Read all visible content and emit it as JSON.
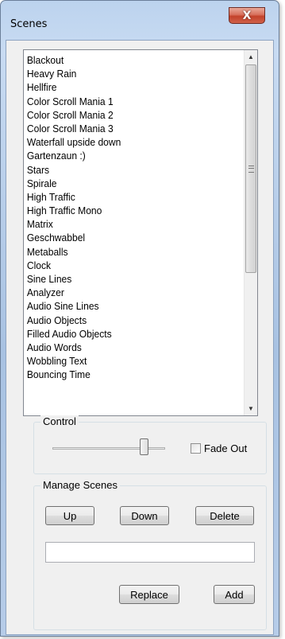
{
  "window": {
    "title": "Scenes",
    "close_glyph": "X"
  },
  "scenes": {
    "items": [
      "Blackout",
      "Heavy Rain",
      "Hellfire",
      "Color Scroll Mania 1",
      "Color Scroll Mania 2",
      "Color Scroll Mania 3",
      "Waterfall upside down",
      "Gartenzaun :)",
      "Stars",
      "Spirale",
      "High Traffic",
      "High Traffic Mono",
      "Matrix",
      "Geschwabbel",
      "Metaballs",
      "Clock",
      "Sine Lines",
      "Analyzer",
      "Audio Sine Lines",
      "Audio Objects",
      "Filled Audio Objects",
      "Audio Words",
      "Wobbling Text",
      "Bouncing Time"
    ],
    "scroll_up_glyph": "▲",
    "scroll_down_glyph": "▼"
  },
  "control": {
    "label": "Control",
    "fade_out_label": "Fade Out",
    "fade_out_checked": false,
    "slider_level": 0.81
  },
  "manage": {
    "label": "Manage Scenes",
    "up_label": "Up",
    "down_label": "Down",
    "delete_label": "Delete",
    "name_value": "",
    "replace_label": "Replace",
    "add_label": "Add"
  }
}
